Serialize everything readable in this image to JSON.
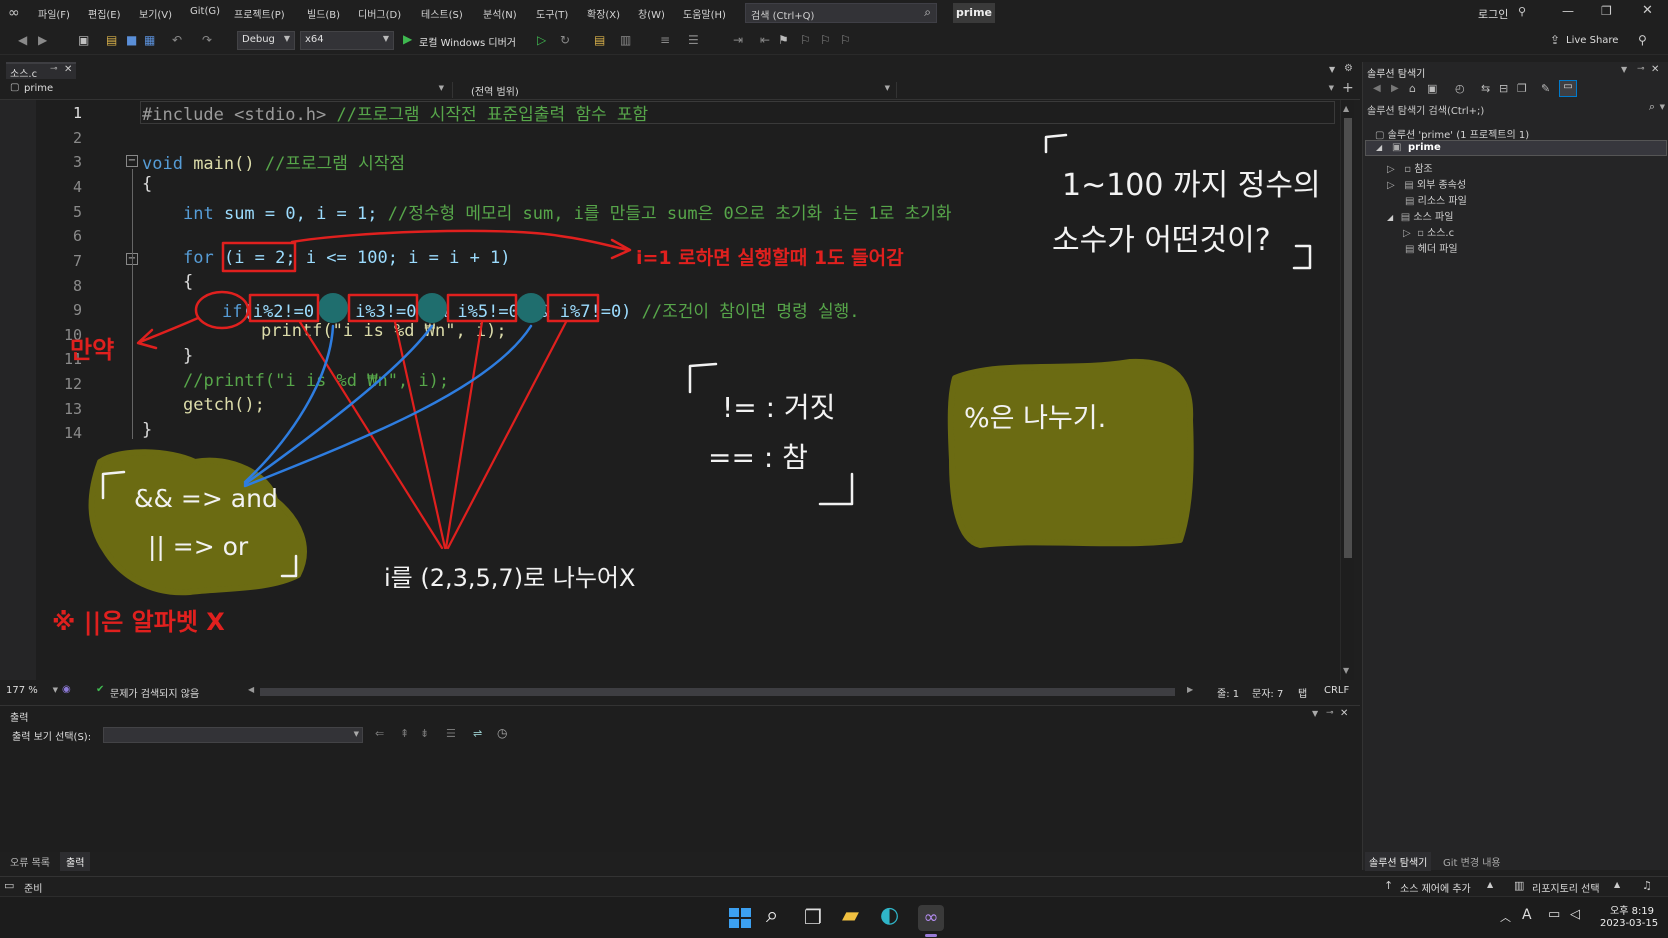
{
  "menu": [
    "파일(F)",
    "편집(E)",
    "보기(V)",
    "Git(G)",
    "프로젝트(P)",
    "빌드(B)",
    "디버그(D)",
    "테스트(S)",
    "분석(N)",
    "도구(T)",
    "확장(X)",
    "창(W)",
    "도움말(H)"
  ],
  "search": {
    "placeholder": "검색 (Ctrl+Q)"
  },
  "project_badge": "prime",
  "login": "로그인",
  "toolbar": {
    "config": "Debug",
    "platform": "x64",
    "run_label": "로컬 Windows 디버거",
    "live_share": "Live Share"
  },
  "editor": {
    "tab_label": "소스.c",
    "nav_project": "prime",
    "nav_scope": "(전역 범위)",
    "line_numbers": [
      "1",
      "2",
      "3",
      "4",
      "5",
      "6",
      "7",
      "8",
      "9",
      "10",
      "11",
      "12",
      "13",
      "14"
    ],
    "code": {
      "l1_pre": "#include <stdio.h>",
      "l1_cm": " //프로그램 시작전 표준입출력 함수 포함",
      "l3_kw": "void",
      "l3_rest": " main()",
      "l3_cm": " //프로그램 시작점",
      "l4": "{",
      "l5_kw": "int",
      "l5_rest": " sum = 0, i = 1;",
      "l5_cm": " //정수형 메모리 sum, i를 만들고 sum은 0으로 초기화 i는 1로 초기화",
      "l7_kw": "for",
      "l7_rest": " (i = 2; i <= 100; i = i + 1)",
      "l8": "{",
      "l9_kw": "if",
      "l9_rest": "(i%2!=0 && i%3!=0 && i%5!=0 && i%7!=0)",
      "l9_cm": " //조건이 참이면 명령 실행.",
      "l10": "printf(\"i is %d ₩n\", i);",
      "l11": "}",
      "l12_cm": "//printf(\"i is %d ₩n\", i);",
      "l13": "getch();",
      "l14": "}"
    },
    "zoom": "177 %",
    "issues": "문제가 검색되지 않음",
    "line": "줄: 1",
    "col": "문자: 7",
    "tab": "탭",
    "eol": "CRLF"
  },
  "annotations": {
    "title_note": [
      "1~100 까지 정수의",
      "소수가 어떤것이?"
    ],
    "for_note": "i=1 로하면 실행할때 1도 들어감",
    "if_note": "만약",
    "ne_note": "!= : 거짓",
    "eq_note": "== : 참",
    "and_note": "&& => and",
    "or_note": "|| => or",
    "pipe_note": "※ ||은 알파벳 X",
    "div_note": "i를 (2,3,5,7)로 나누어X",
    "mod_note": "%은 나누기."
  },
  "output": {
    "title": "출력",
    "show_label": "출력 보기 선택(S):"
  },
  "bottom_tabs": [
    "오류 목록",
    "출력"
  ],
  "solution": {
    "title": "솔루션 탐색기",
    "search_placeholder": "솔루션 탐색기 검색(Ctrl+;)",
    "solution_label": "솔루션 'prime' (1 프로젝트의 1)",
    "project": "prime",
    "items": [
      "참조",
      "외부 종속성",
      "리소스 파일",
      "소스 파일",
      "소스.c",
      "헤더 파일"
    ],
    "tabs": [
      "솔루션 탐색기",
      "Git 변경 내용"
    ]
  },
  "statusbar": {
    "ready": "준비",
    "source_control": "소스 제어에 추가",
    "repo": "리포지토리 선택"
  },
  "clock": {
    "time": "오후 8:19",
    "date": "2023-03-15"
  },
  "colors": {
    "accent": "#007acc",
    "ink_red": "#e0201e",
    "ink_blue": "#2e7de0",
    "ink_white": "#f2f2f2",
    "olive": "#6b6b12",
    "teal": "#1f6e6e"
  }
}
